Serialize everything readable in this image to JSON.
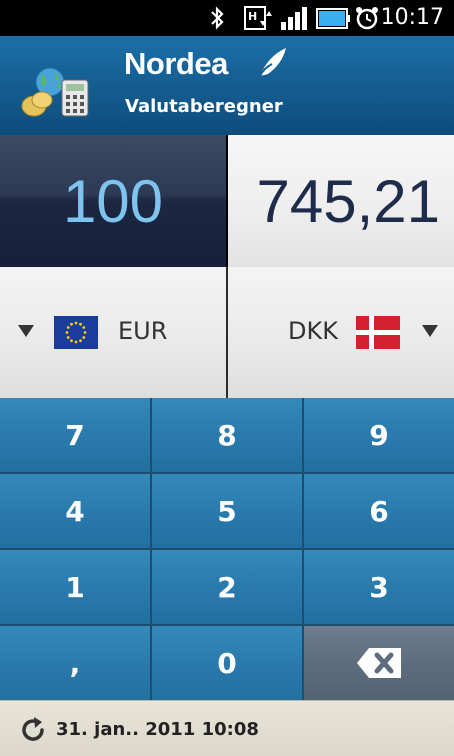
{
  "status_bar": {
    "time": "10:17",
    "icons": [
      "bluetooth-icon",
      "hsdpa-icon",
      "signal-icon",
      "battery-icon",
      "alarm-icon"
    ]
  },
  "header": {
    "brand": "Nordea",
    "subtitle": "Valutaberegner",
    "logo_icon": "currency-calculator-icon"
  },
  "amounts": {
    "from_value": "100",
    "to_value": "745,21"
  },
  "currencies": {
    "from": {
      "code": "EUR",
      "flag": "eu-flag-icon"
    },
    "to": {
      "code": "DKK",
      "flag": "dk-flag-icon"
    }
  },
  "keypad": {
    "keys": [
      "7",
      "8",
      "9",
      "4",
      "5",
      "6",
      "1",
      "2",
      "3",
      ",",
      "0"
    ],
    "backspace_icon": "backspace-icon"
  },
  "footer": {
    "refresh_icon": "refresh-icon",
    "updated": "31. jan.. 2011 10:08"
  },
  "colors": {
    "header_blue": "#155f93",
    "key_blue": "#2a7aad",
    "from_value_color": "#7fc4ee",
    "to_value_color": "#1e2b4a"
  }
}
